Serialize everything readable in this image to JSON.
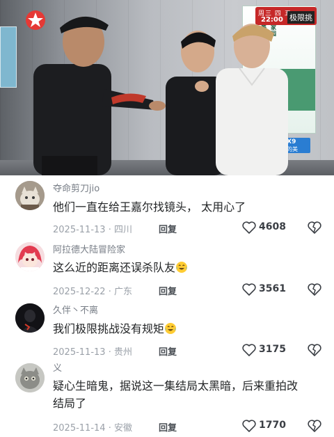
{
  "video": {
    "channel_logo_icon": "dragon-tv-logo-icon",
    "schedule": {
      "day": "周三 四 五",
      "time": "22:00",
      "program": "极限挑"
    },
    "sponsor": {
      "brand": "vivo X9",
      "slogan": "照亮你的美"
    },
    "colors": {
      "schedule_red": "#c62828",
      "sponsor_blue": "#2a7dd2"
    }
  },
  "comments": [
    {
      "username": "夺命剪刀jio",
      "text": "他们一直在给王嘉尔找镜头， 太用心了",
      "date": "2025-11-13",
      "location": "四川",
      "reply_label": "回复",
      "likes": "4608",
      "avatar_icon": "cat-avatar-icon"
    },
    {
      "username": "阿拉德大陆冒险家",
      "text": "这么近的距离还误杀队友",
      "emoji": "crying-laughing-emoji-icon",
      "date": "2025-12-22",
      "location": "广东",
      "reply_label": "回复",
      "likes": "3561",
      "avatar_icon": "anime-girl-avatar-icon"
    },
    {
      "username": "久伴丶不离",
      "text": "我们极限挑战没有规矩",
      "emoji": "crying-laughing-emoji-icon",
      "date": "2025-11-13",
      "location": "贵州",
      "reply_label": "回复",
      "likes": "3175",
      "avatar_icon": "dark-figure-avatar-icon"
    },
    {
      "username": "义",
      "text": "疑心生暗鬼，据说这一集结局太黑暗，后来重拍改结局了",
      "date": "2025-11-14",
      "location": "安徽",
      "reply_label": "回复",
      "likes": "1770",
      "avatar_icon": "grey-cat-avatar-icon"
    }
  ],
  "icons": {
    "like": "heart-outline-icon",
    "dislike": "broken-heart-icon"
  }
}
